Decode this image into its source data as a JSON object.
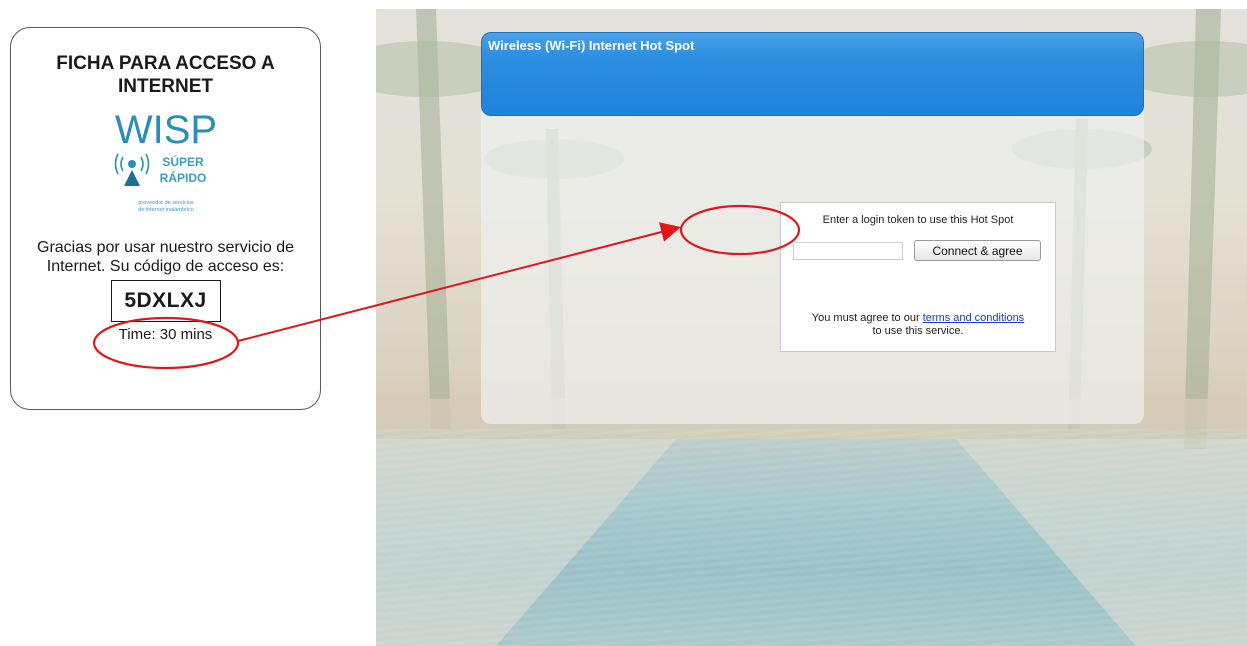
{
  "voucher": {
    "title_line1": "FICHA PARA ACCESO A",
    "title_line2": "INTERNET",
    "logo": {
      "brand": "WISP",
      "tagline_1": "SÚPER",
      "tagline_2": "RÁPIDO",
      "subtitle_1": "proveedor de servicios",
      "subtitle_2": "de internet inalámbrico",
      "icon": "wifi-antenna-icon",
      "color": "#2a8fb8"
    },
    "thanks_text": "Gracias por usar nuestro servicio de Internet. Su código de acceso es:",
    "access_code": "5DXLXJ",
    "time": "Time: 30 mins"
  },
  "hotspot": {
    "header_title": "Wireless (Wi-Fi) Internet Hot Spot",
    "header_color": "#1f83dd",
    "login_prompt": "Enter a login token to use this Hot Spot",
    "token_value": "",
    "connect_button": "Connect & agree",
    "terms_prefix": "You must agree to our ",
    "terms_link": "terms and conditions",
    "terms_suffix": "to use this service."
  },
  "annotation": {
    "highlight_color": "#e0161b",
    "shapes": [
      "code-highlight-ellipse",
      "input-highlight-ellipse",
      "pointer-arrow"
    ]
  }
}
